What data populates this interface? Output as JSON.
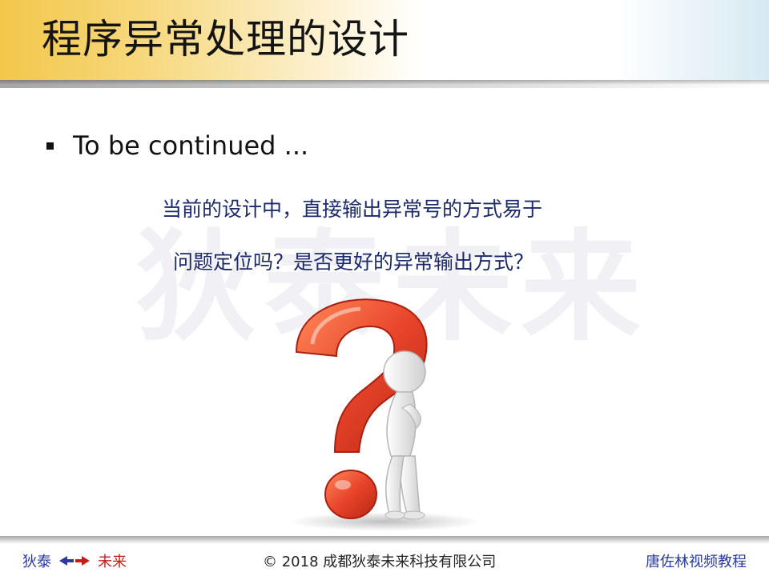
{
  "title": "程序异常处理的设计",
  "watermark": "狄泰未来",
  "bullet": {
    "text": "To be continued ..."
  },
  "question": {
    "line1": "当前的设计中，直接输出异常号的方式易于",
    "line2": "问题定位吗？是否更好的异常输出方式？"
  },
  "footer": {
    "left_a": "狄泰",
    "left_b": "未来",
    "center": "© 2018 成都狄泰未来科技有限公司",
    "right": "唐佐林视频教程"
  },
  "colors": {
    "title_gold": "#f2c74a",
    "question_text": "#1d2a6a",
    "footer_blue": "#2a3a9e",
    "footer_red": "#c0201a",
    "question_mark": "#e8442a"
  },
  "icons": {
    "illustration": "question-mark-with-thinking-figure",
    "footer_arrows": "double-arrow-icon"
  }
}
